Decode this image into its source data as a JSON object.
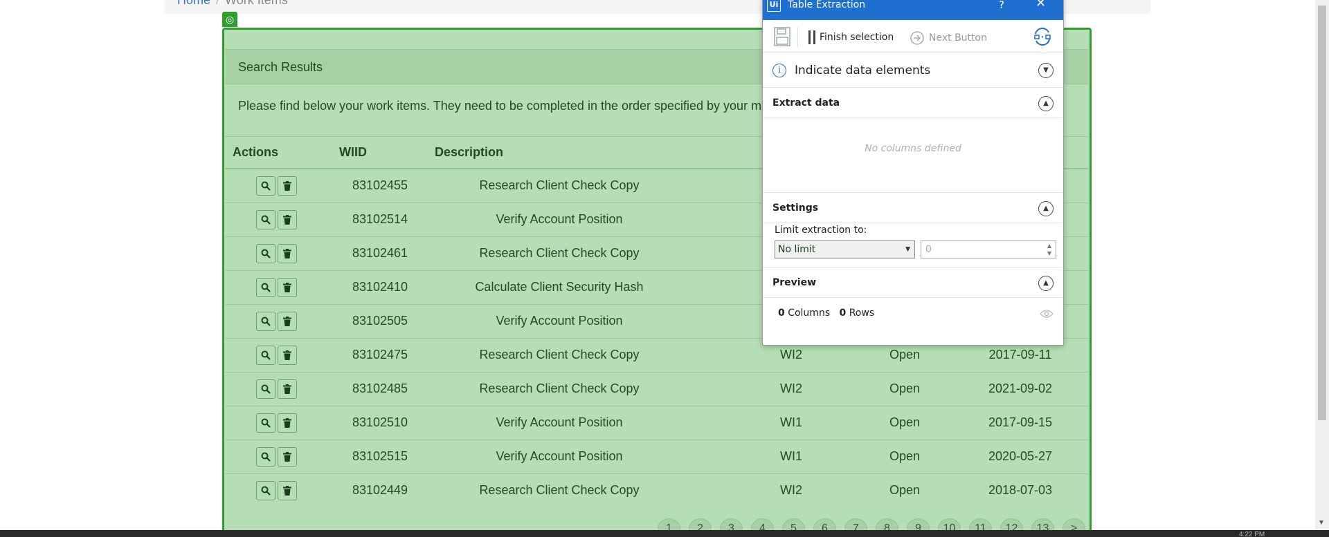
{
  "breadcrumb": {
    "home": "Home",
    "separator": "/",
    "current": "Work Items"
  },
  "panel": {
    "heading": "Search Results",
    "description": "Please find below your work items. They need to be completed in the order specified by your man"
  },
  "table": {
    "headers": [
      "Actions",
      "WIID",
      "Description",
      "",
      "",
      ""
    ],
    "rows": [
      {
        "wiid": "83102455",
        "description": "Research Client Check Copy",
        "type": "",
        "status": "",
        "date": ""
      },
      {
        "wiid": "83102514",
        "description": "Verify Account Position",
        "type": "",
        "status": "",
        "date": ""
      },
      {
        "wiid": "83102461",
        "description": "Research Client Check Copy",
        "type": "",
        "status": "",
        "date": ""
      },
      {
        "wiid": "83102410",
        "description": "Calculate Client Security Hash",
        "type": "",
        "status": "",
        "date": ""
      },
      {
        "wiid": "83102505",
        "description": "Verify Account Position",
        "type": "",
        "status": "",
        "date": ""
      },
      {
        "wiid": "83102475",
        "description": "Research Client Check Copy",
        "type": "WI2",
        "status": "Open",
        "date": "2017-09-11"
      },
      {
        "wiid": "83102485",
        "description": "Research Client Check Copy",
        "type": "WI2",
        "status": "Open",
        "date": "2021-09-02"
      },
      {
        "wiid": "83102510",
        "description": "Verify Account Position",
        "type": "WI1",
        "status": "Open",
        "date": "2017-09-15"
      },
      {
        "wiid": "83102515",
        "description": "Verify Account Position",
        "type": "WI1",
        "status": "Open",
        "date": "2020-05-27"
      },
      {
        "wiid": "83102449",
        "description": "Research Client Check Copy",
        "type": "WI2",
        "status": "Open",
        "date": "2018-07-03"
      }
    ]
  },
  "pagination": [
    "1",
    "2",
    "3",
    "4",
    "5",
    "6",
    "7",
    "8",
    "9",
    "10",
    "11",
    "12",
    "13",
    ">"
  ],
  "taskbar": {
    "time": "4:22 PM"
  },
  "dialog": {
    "title": "Table Extraction",
    "app_icon": "Ui",
    "help": "?",
    "close": "✕",
    "toolbar": {
      "finish_selection": "Finish selection",
      "next_button": "Next Button"
    },
    "indicate": "Indicate data elements",
    "extract_title": "Extract data",
    "no_columns": "No columns defined",
    "settings_title": "Settings",
    "limit_label": "Limit extraction to:",
    "limit_value": "No limit",
    "limit_number": "0",
    "preview_title": "Preview",
    "columns_count": "0",
    "columns_label": "Columns",
    "rows_count": "0",
    "rows_label": "Rows"
  },
  "colors": {
    "selection_green": "#2f9e2f",
    "panel_bg": "#b6deb4",
    "dialog_title": "#1f6fd0"
  }
}
